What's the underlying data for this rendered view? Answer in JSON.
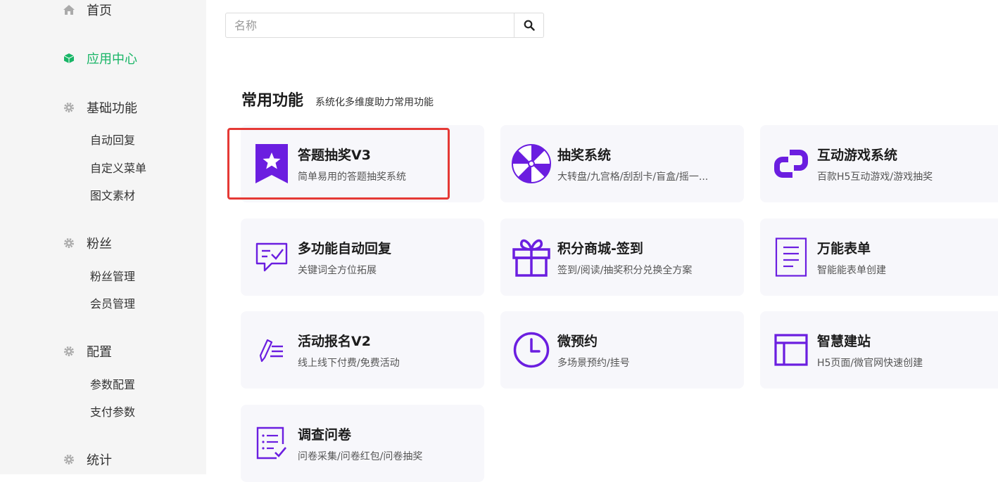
{
  "sidebar": {
    "home": {
      "label": "首页",
      "icon": "home-icon"
    },
    "app_center": {
      "label": "应用中心",
      "icon": "cube-icon",
      "color": "#18b566"
    },
    "basic": {
      "label": "基础功能",
      "icon": "gear-icon",
      "items": [
        "自动回复",
        "自定义菜单",
        "图文素材"
      ]
    },
    "fans": {
      "label": "粉丝",
      "icon": "gear-icon",
      "items": [
        "粉丝管理",
        "会员管理"
      ]
    },
    "config": {
      "label": "配置",
      "icon": "gear-icon",
      "items": [
        "参数配置",
        "支付参数"
      ]
    },
    "stats": {
      "label": "统计",
      "icon": "gear-icon"
    }
  },
  "search": {
    "placeholder": "名称",
    "value": "",
    "icon": "search-icon"
  },
  "section": {
    "title": "常用功能",
    "subtitle": "系统化多维度助力常用功能"
  },
  "cards": [
    {
      "title": "答题抽奖V3",
      "desc": "简单易用的答题抽奖系统",
      "icon": "bookmark-star-icon"
    },
    {
      "title": "抽奖系统",
      "desc": "大转盘/九宫格/刮刮卡/盲盒/摇一...",
      "icon": "wheel-icon"
    },
    {
      "title": "互动游戏系统",
      "desc": "百款H5互动游戏/游戏抽奖",
      "icon": "link-blocks-icon"
    },
    {
      "title": "多功能自动回复",
      "desc": "关键词全方位拓展",
      "icon": "chat-check-icon"
    },
    {
      "title": "积分商城-签到",
      "desc": "签到/阅读/抽奖积分兑换全方案",
      "icon": "gift-icon"
    },
    {
      "title": "万能表单",
      "desc": "智能能表单创建",
      "icon": "document-icon"
    },
    {
      "title": "活动报名V2",
      "desc": "线上线下付费/免费活动",
      "icon": "pen-list-icon"
    },
    {
      "title": "微预约",
      "desc": "多场景预约/挂号",
      "icon": "clock-icon"
    },
    {
      "title": "智慧建站",
      "desc": "H5页面/微官网快速创建",
      "icon": "layout-icon"
    },
    {
      "title": "调查问卷",
      "desc": "问卷采集/问卷红包/问卷抽奖",
      "icon": "checklist-icon"
    }
  ],
  "colors": {
    "accent": "#6b1ee0",
    "active": "#18b566",
    "highlight": "#e53935"
  }
}
